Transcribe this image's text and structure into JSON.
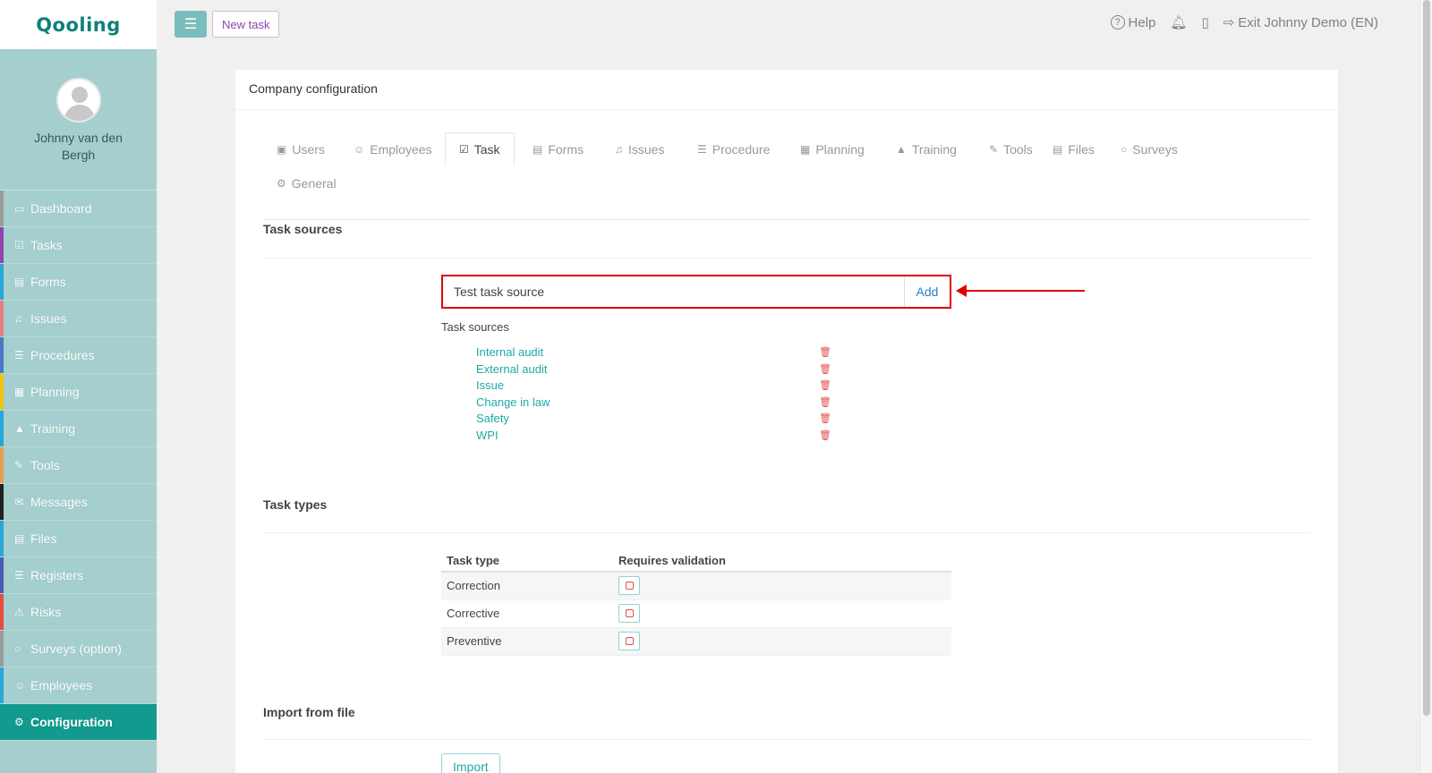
{
  "app": {
    "logo": "Qooling"
  },
  "user": {
    "name": "Johnny van den Bergh"
  },
  "sidebar": {
    "items": [
      {
        "label": "Dashboard",
        "icon": "monitor-icon",
        "color": "#9b9b9b"
      },
      {
        "label": "Tasks",
        "icon": "check-icon",
        "color": "#8e44ad"
      },
      {
        "label": "Forms",
        "icon": "file-icon",
        "color": "#2aa7d6"
      },
      {
        "label": "Issues",
        "icon": "bell-icon",
        "color": "#e87c7c"
      },
      {
        "label": "Procedures",
        "icon": "list-icon",
        "color": "#4a78c6"
      },
      {
        "label": "Planning",
        "icon": "calendar-icon",
        "color": "#f1c40f"
      },
      {
        "label": "Training",
        "icon": "graduation-icon",
        "color": "#2aa7d6"
      },
      {
        "label": "Tools",
        "icon": "wrench-icon",
        "color": "#e8a04c"
      },
      {
        "label": "Messages",
        "icon": "envelope-icon",
        "color": "#222222"
      },
      {
        "label": "Files",
        "icon": "file-icon",
        "color": "#2aa7d6"
      },
      {
        "label": "Registers",
        "icon": "list-icon",
        "color": "#4a5ab6"
      },
      {
        "label": "Risks",
        "icon": "warning-icon",
        "color": "#e74c3c"
      },
      {
        "label": "Surveys (option)",
        "icon": "comment-icon",
        "color": "#9b9b9b"
      },
      {
        "label": "Employees",
        "icon": "users-icon",
        "color": "#2aa7d6"
      },
      {
        "label": "Configuration",
        "icon": "gear-icon",
        "color": "#119a8d",
        "active": true
      }
    ]
  },
  "topbar": {
    "menu_icon": "hamburger-icon",
    "new_task": "New task",
    "help": "Help",
    "exit": "Exit Johnny Demo (EN)"
  },
  "panel": {
    "title": "Company configuration",
    "tabs": [
      {
        "label": "Users",
        "icon": "id-card-icon"
      },
      {
        "label": "Employees",
        "icon": "users-icon"
      },
      {
        "label": "Task",
        "icon": "check-icon",
        "active": true
      },
      {
        "label": "Forms",
        "icon": "file-icon"
      },
      {
        "label": "Issues",
        "icon": "bell-icon"
      },
      {
        "label": "Procedure",
        "icon": "list-icon"
      },
      {
        "label": "Planning",
        "icon": "calendar-icon"
      },
      {
        "label": "Training",
        "icon": "graduation-icon"
      },
      {
        "label": "Tools",
        "icon": "wrench-icon"
      },
      {
        "label": "Files",
        "icon": "file-icon"
      },
      {
        "label": "Surveys",
        "icon": "comment-icon"
      },
      {
        "label": "General",
        "icon": "gear-icon"
      }
    ]
  },
  "task_sources": {
    "section_title": "Task sources",
    "input_value": "Test task source",
    "add_label": "Add",
    "list_label": "Task sources",
    "items": [
      "Internal audit",
      "External audit",
      "Issue",
      "Change in law",
      "Safety",
      "WPI"
    ]
  },
  "task_types": {
    "section_title": "Task types",
    "columns": [
      "Task type",
      "Requires validation"
    ],
    "rows": [
      {
        "type": "Correction",
        "requires_validation": false
      },
      {
        "type": "Corrective",
        "requires_validation": false
      },
      {
        "type": "Preventive",
        "requires_validation": false
      }
    ]
  },
  "import": {
    "section_title": "Import from file",
    "button": "Import"
  },
  "colors": {
    "accent": "#119a8d",
    "sidebar_bg": "#a4cfce",
    "highlight": "#e00000",
    "link": "#22a7a7"
  }
}
